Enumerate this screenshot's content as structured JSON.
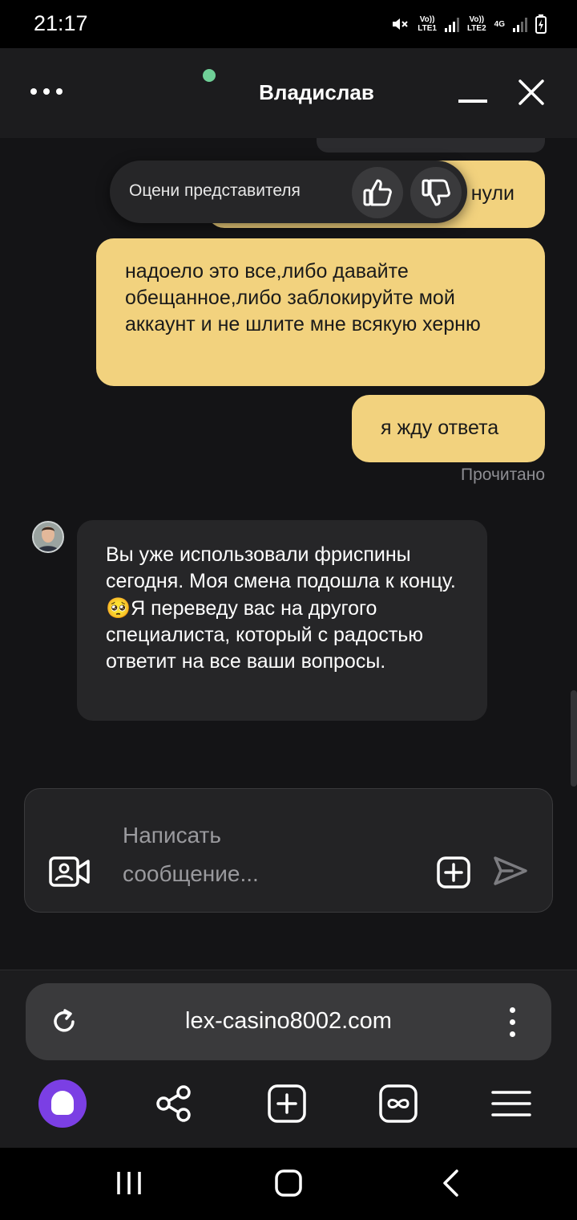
{
  "status_bar": {
    "time": "21:17",
    "sim1_label": "Vo))\nLTE1",
    "sim2_label": "Vo))\nLTE2",
    "network_type": "4G",
    "icons": [
      "mute-icon",
      "signal-icon",
      "signal-icon",
      "battery-charging-icon"
    ]
  },
  "header": {
    "title": "Владислав",
    "online": true,
    "menu_icon": "more-horizontal-icon",
    "minimize_icon": "minimize-icon",
    "close_icon": "close-icon"
  },
  "rating_popup": {
    "label": "Оцени представителя",
    "like_icon": "thumbs-up-icon",
    "dislike_icon": "thumbs-down-icon"
  },
  "messages": [
    {
      "from": "user",
      "text": "нули"
    },
    {
      "from": "user",
      "text": "надоело это все,либо давайте обещанное,либо заблокируйте мой аккаунт и не шлите мне всякую херню"
    },
    {
      "from": "user",
      "text": "я жду ответа"
    },
    {
      "from": "agent",
      "text_before": "Вы уже использовали фриспины сегодня. Моя смена подошла к концу. ",
      "emoji": "🥺",
      "text_after": "Я переведу вас на другого специалиста, который с радостью ответит на все ваши вопросы."
    }
  ],
  "read_status": "Прочитано",
  "composer": {
    "placeholder": "Написать сообщение...",
    "video_icon": "video-call-icon",
    "attach_icon": "add-attachment-icon",
    "send_icon": "send-icon"
  },
  "browser": {
    "url": "lex-casino8002.com",
    "toolbar": [
      "alice-assistant-icon",
      "share-icon",
      "new-tab-icon",
      "tabs-icon",
      "menu-icon"
    ]
  },
  "colors": {
    "user_bubble": "#f2d27e",
    "agent_bubble": "#262628",
    "background": "#141416",
    "online": "#6fcf97",
    "alice": "#7b3fe4"
  }
}
